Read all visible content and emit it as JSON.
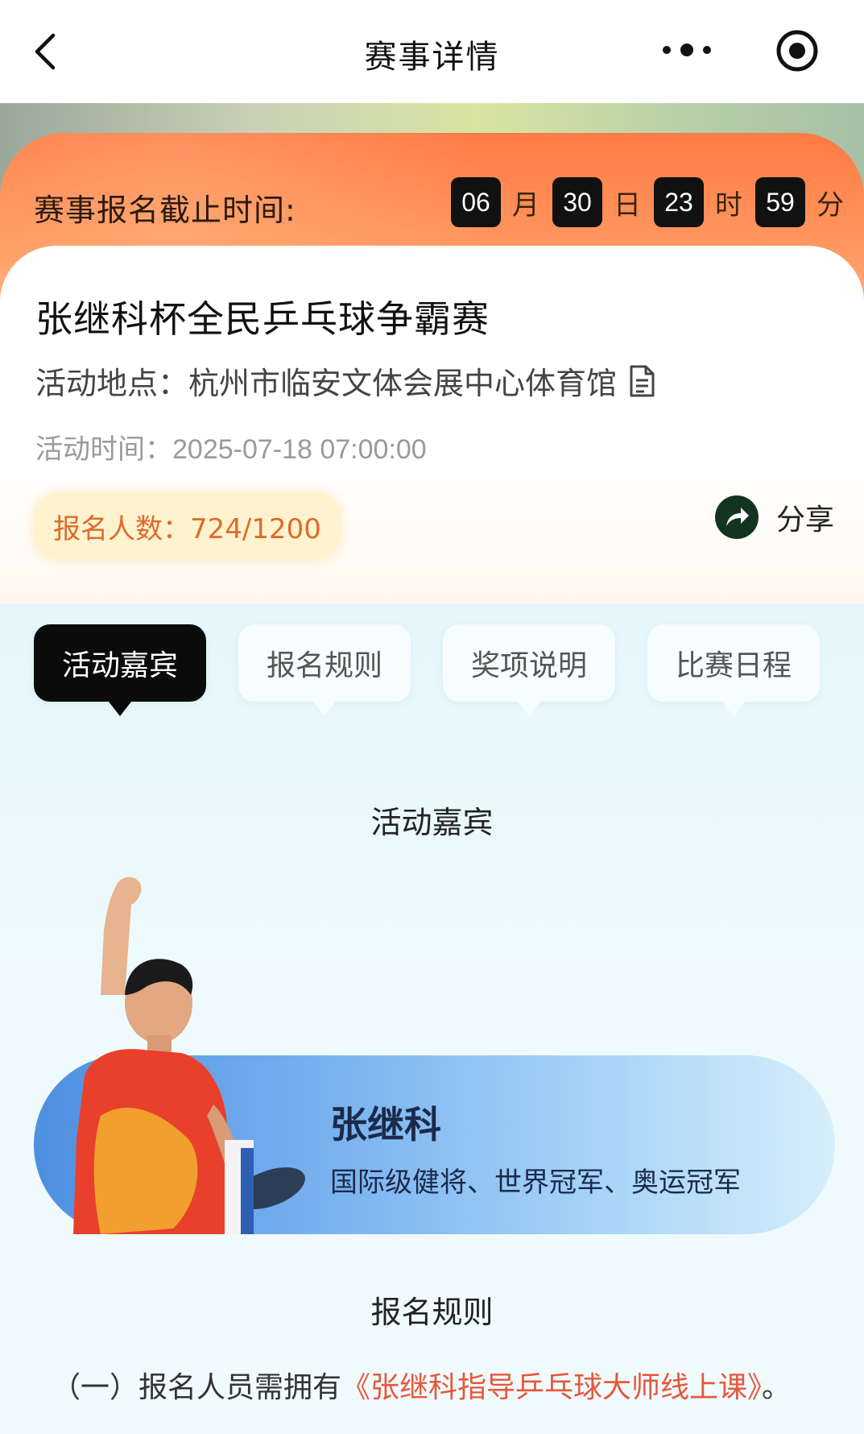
{
  "nav": {
    "title": "赛事详情"
  },
  "deadline": {
    "label": "赛事报名截止时间:",
    "month": "06",
    "month_unit": "月",
    "day": "30",
    "day_unit": "日",
    "hour": "23",
    "hour_unit": "时",
    "minute": "59",
    "minute_unit": "分"
  },
  "event": {
    "title": "张继科杯全民乒乓球争霸赛",
    "location": "活动地点：杭州市临安文体会展中心体育馆",
    "time": "活动时间：2025-07-18 07:00:00",
    "signup_count": "报名人数：724/1200",
    "share_label": "分享"
  },
  "tabs": [
    {
      "label": "活动嘉宾",
      "active": true
    },
    {
      "label": "报名规则",
      "active": false
    },
    {
      "label": "奖项说明",
      "active": false
    },
    {
      "label": "比赛日程",
      "active": false
    }
  ],
  "guests": {
    "heading": "活动嘉宾",
    "name": "张继科",
    "description": "国际级健将、世界冠军、奥运冠军"
  },
  "rules": {
    "heading": "报名规则",
    "line_prefix": "（一）报名人员需拥有",
    "line_link": "《张继科指导乒乓球大师线上课》",
    "line_suffix": "。"
  },
  "colors": {
    "accent_orange": "#ff7a45",
    "link_red": "#e8573b",
    "signup_text": "#e06a2a",
    "tab_active_bg": "#0b0b0b"
  }
}
